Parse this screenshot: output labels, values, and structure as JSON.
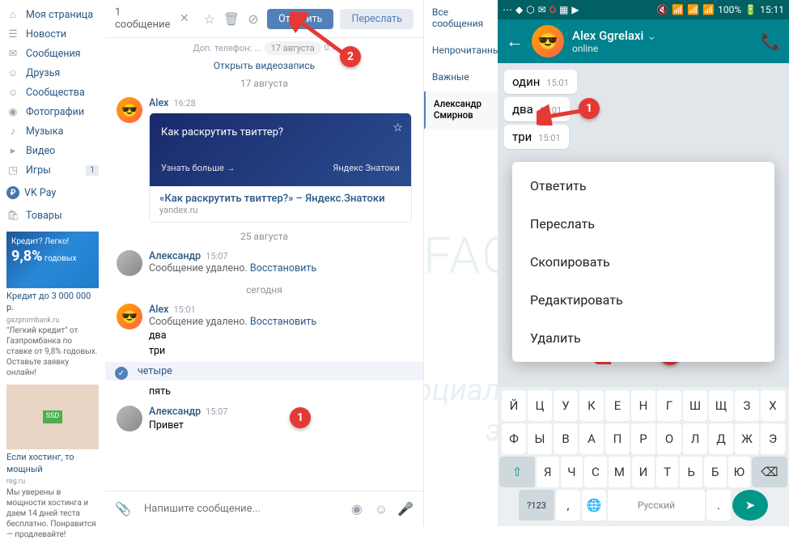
{
  "sidebar": {
    "items": [
      {
        "icon": "home",
        "label": "Моя страница"
      },
      {
        "icon": "news",
        "label": "Новости"
      },
      {
        "icon": "msg",
        "label": "Сообщения"
      },
      {
        "icon": "friends",
        "label": "Друзья"
      },
      {
        "icon": "groups",
        "label": "Сообщества"
      },
      {
        "icon": "photo",
        "label": "Фотографии"
      },
      {
        "icon": "music",
        "label": "Музыка"
      },
      {
        "icon": "video",
        "label": "Видео"
      },
      {
        "icon": "games",
        "label": "Игры",
        "count": "1"
      }
    ],
    "vkpay": "VK Pay",
    "goods": "Товары"
  },
  "ads": {
    "ad1": {
      "line1": "Кредит? Легко!",
      "rate": "9,8%",
      "sub": "годовых",
      "title": "Кредит до 3 000 000 р.",
      "domain": "gazprombank.ru",
      "text": "\"Легкий кредит\" от Газпромбанка по ставке от 9,8% годовых. Оставьте заявку онлайн!"
    },
    "ad2": {
      "badge": "SSD",
      "title": "Если хостинг, то мощный",
      "domain": "reg.ru",
      "text": "Мы уверены в мощности хостинга и даем 14 дней теста бесплатно. Понравится — продлевайте!"
    }
  },
  "topbar": {
    "selected": "1 сообщение",
    "reply": "Ответить",
    "forward": "Переслать"
  },
  "hints": {
    "phone": "Доп. телефон: ...",
    "date_pill": "17 августа",
    "video": "Открыть видеозапись"
  },
  "dates": {
    "d1": "17 августа",
    "d2": "25 августа",
    "d3": "сегодня"
  },
  "msg1": {
    "name": "Alex",
    "time": "16:28",
    "question": "Как раскрутить твиттер?",
    "more": "Узнать больше →",
    "brand": "Яндекс Знатоки",
    "title": "«Как раскрутить твиттер?» – Яндекс.Знатоки",
    "domain": "yandex.ru"
  },
  "msg2": {
    "name": "Александр",
    "time": "15:07",
    "deleted": "Сообщение удалено.",
    "restore": "Восстановить"
  },
  "msg3": {
    "name": "Alex",
    "time": "15:01",
    "deleted": "Сообщение удалено.",
    "restore": "Восстановить",
    "l1": "два",
    "l2": "три",
    "l3": "четыре",
    "l4": "пять"
  },
  "msg4": {
    "name": "Александр",
    "time": "15:07",
    "text": "Привет"
  },
  "input": {
    "placeholder": "Напишите сообщение..."
  },
  "tabs": {
    "all": "Все сообщения",
    "unread": "Непрочитанные",
    "important": "Важные",
    "active": "Александр Смирнов"
  },
  "watermark": {
    "main": "Soc-FAQ.ru",
    "sub1": "Социальные сети",
    "sub2": "это просто!"
  },
  "badges": {
    "b1": "1",
    "b2": "2"
  },
  "mobile": {
    "status": {
      "battery": "100%",
      "time": "15:11"
    },
    "header": {
      "name": "Alex Ggrelaxi",
      "status": "online"
    },
    "bubbles": [
      {
        "txt": "один",
        "tm": "15:01"
      },
      {
        "txt": "два",
        "tm": "15:01"
      },
      {
        "txt": "три",
        "tm": "15:01"
      }
    ],
    "menu": [
      "Ответить",
      "Переслать",
      "Скопировать",
      "Редактировать",
      "Удалить"
    ],
    "kb": {
      "r1": [
        "Й",
        "Ц",
        "У",
        "К",
        "Е",
        "Н",
        "Г",
        "Ш",
        "Щ",
        "З",
        "Х"
      ],
      "r2": [
        "Ф",
        "Ы",
        "В",
        "А",
        "П",
        "Р",
        "О",
        "Л",
        "Д",
        "Ж",
        "Э"
      ],
      "r3": [
        "Я",
        "Ч",
        "С",
        "М",
        "И",
        "Т",
        "Ь",
        "Б",
        "Ю"
      ],
      "r4": {
        "num": "?123",
        "lang": "Русский"
      }
    }
  }
}
